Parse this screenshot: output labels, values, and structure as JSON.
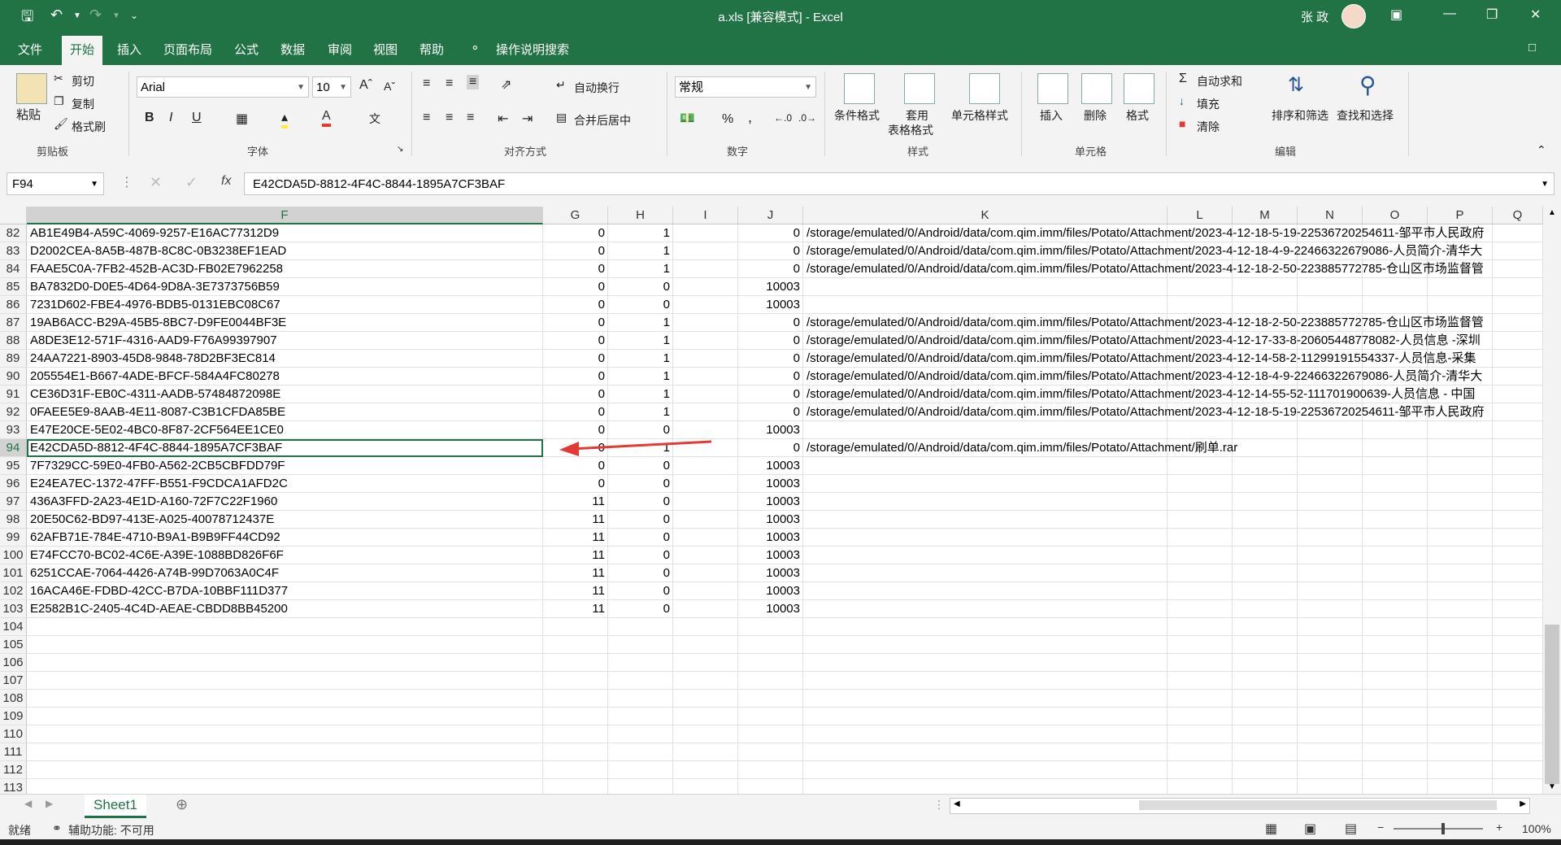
{
  "window": {
    "title": "a.xls [兼容模式] - Excel",
    "user_name": "张 政"
  },
  "tabs": [
    "文件",
    "开始",
    "插入",
    "页面布局",
    "公式",
    "数据",
    "审阅",
    "视图",
    "帮助"
  ],
  "tell_me": "操作说明搜索",
  "ribbon": {
    "clipboard": {
      "paste": "粘贴",
      "cut": "剪切",
      "copy": "复制",
      "format_painter": "格式刷",
      "label": "剪贴板"
    },
    "font": {
      "name": "Arial",
      "size": "10",
      "bold": "B",
      "italic": "I",
      "underline": "U",
      "label": "字体"
    },
    "alignment": {
      "wrap": "自动换行",
      "merge": "合并后居中",
      "label": "对齐方式"
    },
    "number": {
      "format": "常规",
      "percent": "%",
      "comma": ",",
      "label": "数字"
    },
    "styles": {
      "conditional": "条件格式",
      "table_line1": "套用",
      "table_line2": "表格格式",
      "cell_styles": "单元格样式",
      "label": "样式"
    },
    "cells": {
      "insert": "插入",
      "delete": "删除",
      "format": "格式",
      "label": "单元格"
    },
    "editing": {
      "autosum": "自动求和",
      "fill": "填充",
      "clear": "清除",
      "sort": "排序和筛选",
      "find": "查找和选择",
      "label": "编辑"
    }
  },
  "formula_bar": {
    "name_box": "F94",
    "fx": "fx",
    "content": "E42CDA5D-8812-4F4C-8844-1895A7CF3BAF"
  },
  "columns": [
    "F",
    "G",
    "H",
    "I",
    "J",
    "K",
    "L",
    "M",
    "N",
    "O",
    "P",
    "Q"
  ],
  "rows": [
    {
      "n": "82",
      "f": "AB1E49B4-A59C-4069-9257-E16AC77312D9",
      "g": "0",
      "h": "1",
      "j": "0",
      "k": "/storage/emulated/0/Android/data/com.qim.imm/files/Potato/Attachment/2023-4-12-18-5-19-22536720254611-邹平市人民政府"
    },
    {
      "n": "83",
      "f": "D2002CEA-8A5B-487B-8C8C-0B3238EF1EAD",
      "g": "0",
      "h": "1",
      "j": "0",
      "k": "/storage/emulated/0/Android/data/com.qim.imm/files/Potato/Attachment/2023-4-12-18-4-9-22466322679086-人员简介-清华大"
    },
    {
      "n": "84",
      "f": "FAAE5C0A-7FB2-452B-AC3D-FB02E7962258",
      "g": "0",
      "h": "1",
      "j": "0",
      "k": "/storage/emulated/0/Android/data/com.qim.imm/files/Potato/Attachment/2023-4-12-18-2-50-223885772785-仓山区市场监督管"
    },
    {
      "n": "85",
      "f": "BA7832D0-D0E5-4D64-9D8A-3E7373756B59",
      "g": "0",
      "h": "0",
      "j": "10003",
      "k": ""
    },
    {
      "n": "86",
      "f": "7231D602-FBE4-4976-BDB5-0131EBC08C67",
      "g": "0",
      "h": "0",
      "j": "10003",
      "k": ""
    },
    {
      "n": "87",
      "f": "19AB6ACC-B29A-45B5-8BC7-D9FE0044BF3E",
      "g": "0",
      "h": "1",
      "j": "0",
      "k": "/storage/emulated/0/Android/data/com.qim.imm/files/Potato/Attachment/2023-4-12-18-2-50-223885772785-仓山区市场监督管"
    },
    {
      "n": "88",
      "f": "A8DE3E12-571F-4316-AAD9-F76A99397907",
      "g": "0",
      "h": "1",
      "j": "0",
      "k": "/storage/emulated/0/Android/data/com.qim.imm/files/Potato/Attachment/2023-4-12-17-33-8-20605448778082-人员信息 -深圳"
    },
    {
      "n": "89",
      "f": "24AA7221-8903-45D8-9848-78D2BF3EC814",
      "g": "0",
      "h": "1",
      "j": "0",
      "k": "/storage/emulated/0/Android/data/com.qim.imm/files/Potato/Attachment/2023-4-12-14-58-2-11299191554337-人员信息-采集"
    },
    {
      "n": "90",
      "f": "205554E1-B667-4ADE-BFCF-584A4FC80278",
      "g": "0",
      "h": "1",
      "j": "0",
      "k": "/storage/emulated/0/Android/data/com.qim.imm/files/Potato/Attachment/2023-4-12-18-4-9-22466322679086-人员简介-清华大"
    },
    {
      "n": "91",
      "f": "CE36D31F-EB0C-4311-AADB-57484872098E",
      "g": "0",
      "h": "1",
      "j": "0",
      "k": "/storage/emulated/0/Android/data/com.qim.imm/files/Potato/Attachment/2023-4-12-14-55-52-111701900639-人员信息 - 中国"
    },
    {
      "n": "92",
      "f": "0FAEE5E9-8AAB-4E11-8087-C3B1CFDA85BE",
      "g": "0",
      "h": "1",
      "j": "0",
      "k": "/storage/emulated/0/Android/data/com.qim.imm/files/Potato/Attachment/2023-4-12-18-5-19-22536720254611-邹平市人民政府"
    },
    {
      "n": "93",
      "f": "E47E20CE-5E02-4BC0-8F87-2CF564EE1CE0",
      "g": "0",
      "h": "0",
      "j": "10003",
      "k": ""
    },
    {
      "n": "94",
      "f": "E42CDA5D-8812-4F4C-8844-1895A7CF3BAF",
      "g": "0",
      "h": "1",
      "j": "0",
      "k": "/storage/emulated/0/Android/data/com.qim.imm/files/Potato/Attachment/刷单.rar"
    },
    {
      "n": "95",
      "f": "7F7329CC-59E0-4FB0-A562-2CB5CBFDD79F",
      "g": "0",
      "h": "0",
      "j": "10003",
      "k": ""
    },
    {
      "n": "96",
      "f": "E24EA7EC-1372-47FF-B551-F9CDCA1AFD2C",
      "g": "0",
      "h": "0",
      "j": "10003",
      "k": ""
    },
    {
      "n": "97",
      "f": "436A3FFD-2A23-4E1D-A160-72F7C22F1960",
      "g": "11",
      "h": "0",
      "j": "10003",
      "k": ""
    },
    {
      "n": "98",
      "f": "20E50C62-BD97-413E-A025-40078712437E",
      "g": "11",
      "h": "0",
      "j": "10003",
      "k": ""
    },
    {
      "n": "99",
      "f": "62AFB71E-784E-4710-B9A1-B9B9FF44CD92",
      "g": "11",
      "h": "0",
      "j": "10003",
      "k": ""
    },
    {
      "n": "100",
      "f": "E74FCC70-BC02-4C6E-A39E-1088BD826F6F",
      "g": "11",
      "h": "0",
      "j": "10003",
      "k": ""
    },
    {
      "n": "101",
      "f": "6251CCAE-7064-4426-A74B-99D7063A0C4F",
      "g": "11",
      "h": "0",
      "j": "10003",
      "k": ""
    },
    {
      "n": "102",
      "f": "16ACA46E-FDBD-42CC-B7DA-10BBF111D377",
      "g": "11",
      "h": "0",
      "j": "10003",
      "k": ""
    },
    {
      "n": "103",
      "f": "E2582B1C-2405-4C4D-AEAE-CBDD8BB45200",
      "g": "11",
      "h": "0",
      "j": "10003",
      "k": ""
    },
    {
      "n": "104",
      "f": "",
      "g": "",
      "h": "",
      "j": "",
      "k": ""
    },
    {
      "n": "105",
      "f": "",
      "g": "",
      "h": "",
      "j": "",
      "k": ""
    },
    {
      "n": "106",
      "f": "",
      "g": "",
      "h": "",
      "j": "",
      "k": ""
    },
    {
      "n": "107",
      "f": "",
      "g": "",
      "h": "",
      "j": "",
      "k": ""
    },
    {
      "n": "108",
      "f": "",
      "g": "",
      "h": "",
      "j": "",
      "k": ""
    },
    {
      "n": "109",
      "f": "",
      "g": "",
      "h": "",
      "j": "",
      "k": ""
    },
    {
      "n": "110",
      "f": "",
      "g": "",
      "h": "",
      "j": "",
      "k": ""
    },
    {
      "n": "111",
      "f": "",
      "g": "",
      "h": "",
      "j": "",
      "k": ""
    },
    {
      "n": "112",
      "f": "",
      "g": "",
      "h": "",
      "j": "",
      "k": ""
    },
    {
      "n": "113",
      "f": "",
      "g": "",
      "h": "",
      "j": "",
      "k": ""
    }
  ],
  "selected_row": "94",
  "sheet_tab": "Sheet1",
  "status": {
    "ready": "就绪",
    "accessibility": "辅助功能: 不可用",
    "zoom": "100%"
  },
  "colors": {
    "accent": "#217346",
    "arrow": "#e53935"
  }
}
